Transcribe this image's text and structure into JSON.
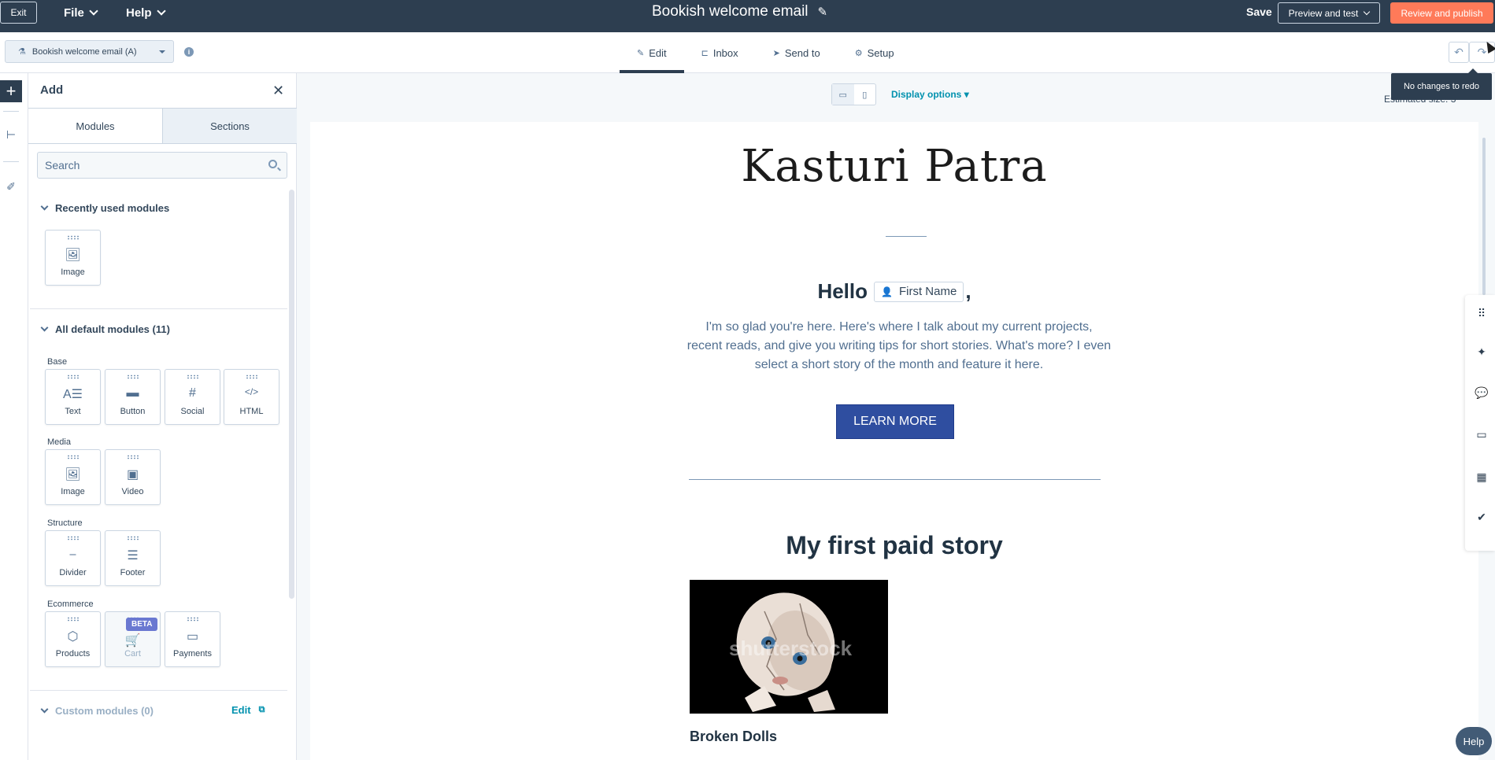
{
  "topbar": {
    "exit_label": "Exit",
    "file_label": "File",
    "help_label": "Help",
    "email_title": "Bookish welcome email",
    "save_label": "Save",
    "preview_label": "Preview and test",
    "publish_label": "Review and publish"
  },
  "subbar": {
    "variant_label": "Bookish welcome email (A)",
    "tabs": [
      {
        "label": "Edit",
        "icon": "pencil-icon"
      },
      {
        "label": "Inbox",
        "icon": "inbox-icon"
      },
      {
        "label": "Send to",
        "icon": "send-icon"
      },
      {
        "label": "Setup",
        "icon": "gear-icon"
      }
    ],
    "active_tab": "Edit",
    "redo_tooltip": "No changes to redo"
  },
  "panel": {
    "title": "Add",
    "tabs": [
      {
        "label": "Modules"
      },
      {
        "label": "Sections"
      }
    ],
    "search_placeholder": "Search",
    "recent": {
      "title": "Recently used modules",
      "modules": [
        {
          "label": "Image",
          "icon": "image-icon"
        }
      ]
    },
    "defaults": {
      "title": "All default modules (11)",
      "categories": {
        "base": {
          "label": "Base",
          "modules": [
            {
              "label": "Text",
              "icon": "text-icon"
            },
            {
              "label": "Button",
              "icon": "button-icon"
            },
            {
              "label": "Social",
              "icon": "social-icon"
            },
            {
              "label": "HTML",
              "icon": "code-icon"
            }
          ]
        },
        "media": {
          "label": "Media",
          "modules": [
            {
              "label": "Image",
              "icon": "image-icon"
            },
            {
              "label": "Video",
              "icon": "video-icon"
            }
          ]
        },
        "structure": {
          "label": "Structure",
          "modules": [
            {
              "label": "Divider",
              "icon": "divider-icon"
            },
            {
              "label": "Footer",
              "icon": "footer-icon"
            }
          ]
        },
        "ecommerce": {
          "label": "Ecommerce",
          "modules": [
            {
              "label": "Products",
              "icon": "box-icon"
            },
            {
              "label": "Cart",
              "icon": "cart-icon",
              "badge": "BETA",
              "disabled": true
            },
            {
              "label": "Payments",
              "icon": "card-icon"
            }
          ]
        }
      }
    },
    "custom": {
      "title": "Custom modules (0)",
      "edit_label": "Edit"
    }
  },
  "canvas": {
    "display_options": "Display options",
    "estimated_size": "Estimated size: 3",
    "email": {
      "brand": "Kasturi Patra",
      "hello": "Hello",
      "token": "First Name",
      "comma": ",",
      "intro": "I'm so glad you're here. Here's where I talk about my current projects, recent reads, and give you writing tips for short stories. What's more? I even select a short story of the month and feature it here.",
      "button": "LEARN MORE",
      "story_title": "My first paid story",
      "image_watermark": "shutterstock",
      "story_caption": "Broken Dolls"
    }
  },
  "help_label": "Help",
  "colors": {
    "topbar": "#2d3e50",
    "accent_orange": "#ff7a59",
    "link_teal": "#0091ae",
    "email_button": "#2f4ea0",
    "beta_badge": "#6a78d1"
  }
}
